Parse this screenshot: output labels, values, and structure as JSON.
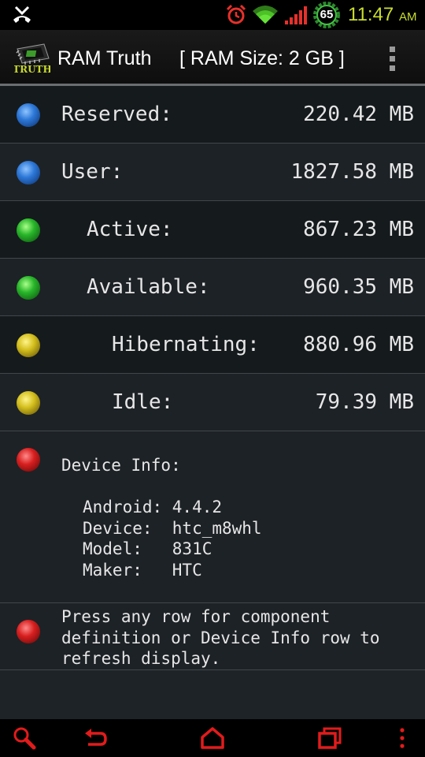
{
  "status_bar": {
    "battery": "65",
    "time": "11:47",
    "ampm": "AM",
    "accent_color": "#c9de2e",
    "icons": [
      "missed-call-icon",
      "alarm-icon",
      "wifi-icon",
      "signal-icon",
      "battery-icon"
    ]
  },
  "action_bar": {
    "logo_text": "TRUTH",
    "title": "RAM Truth",
    "ram_size": "[ RAM Size: 2 GB ]",
    "menu_icon": "overflow-menu-icon"
  },
  "memory_rows": [
    {
      "label": "Reserved:",
      "value": "220.42 MB",
      "color": "blue"
    },
    {
      "label": "User:",
      "value": "1827.58 MB",
      "color": "blue"
    },
    {
      "label": "Active:",
      "value": "867.23 MB",
      "color": "green"
    },
    {
      "label": "Available:",
      "value": "960.35 MB",
      "color": "green"
    },
    {
      "label": "Hibernating:",
      "value": "880.96 MB",
      "color": "yellow"
    },
    {
      "label": "Idle:",
      "value": "79.39 MB",
      "color": "yellow"
    }
  ],
  "device_info": {
    "title": "Device Info:",
    "lines": [
      "Android: 4.4.2",
      "Device:  htc_m8whl",
      "Model:   831C",
      "Maker:   HTC"
    ]
  },
  "hint": {
    "text": "Press any row for component definition or Device Info row to refresh display."
  },
  "nav_bar": {
    "accent_color": "#e21b1b",
    "icons": [
      "search-icon",
      "back-icon",
      "home-icon",
      "recents-icon",
      "more-icon"
    ]
  }
}
